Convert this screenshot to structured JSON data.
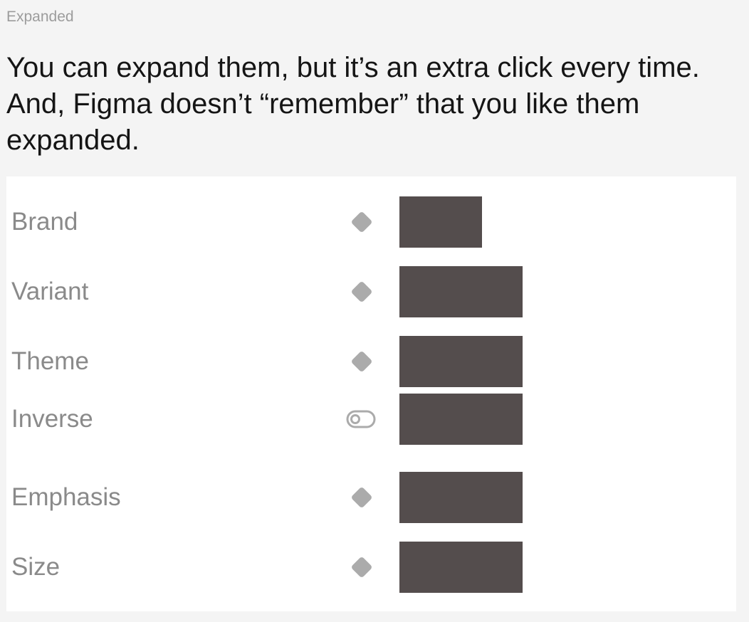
{
  "caption": "Expanded",
  "description": "You can expand them, but it’s an extra click every time. And, Figma doesn’t “remember” that you like them expanded.",
  "properties": [
    {
      "label": "Brand",
      "icon": "diamond-icon",
      "control": "variant-dropdown"
    },
    {
      "label": "Variant",
      "icon": "diamond-icon",
      "control": "variant-dropdown"
    },
    {
      "label": "Theme",
      "icon": "diamond-icon",
      "control": "variant-dropdown"
    },
    {
      "label": "Inverse",
      "icon": "toggle-icon",
      "control": "boolean-toggle"
    },
    {
      "label": "Emphasis",
      "icon": "diamond-icon",
      "control": "variant-dropdown"
    },
    {
      "label": "Size",
      "icon": "diamond-icon",
      "control": "variant-dropdown"
    }
  ],
  "colors": {
    "background": "#f4f4f4",
    "panel": "#ffffff",
    "label": "#8a8a8a",
    "icon": "#ababab",
    "redacted_value": "#544d4d",
    "text": "#151515"
  }
}
